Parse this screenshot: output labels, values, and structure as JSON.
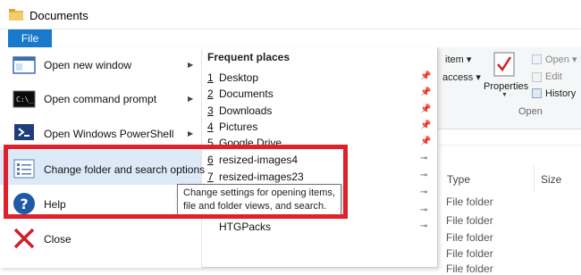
{
  "window": {
    "title": "Documents"
  },
  "ribbon": {
    "file_tab": "File",
    "item": "item",
    "access": "access",
    "properties": "Properties",
    "open": "Open",
    "edit": "Edit",
    "history": "History",
    "group_open": "Open"
  },
  "menu": {
    "items": [
      {
        "label": "Open new window",
        "icon": "window-icon",
        "has_submenu": true
      },
      {
        "label": "Open command prompt",
        "icon": "command-prompt-icon",
        "has_submenu": true
      },
      {
        "label": "Open Windows PowerShell",
        "icon": "powershell-icon",
        "has_submenu": true
      },
      {
        "label": "Change folder and search options",
        "icon": "folder-options-icon",
        "has_submenu": false
      },
      {
        "label": "Help",
        "icon": "help-icon",
        "has_submenu": true
      },
      {
        "label": "Close",
        "icon": "close-icon",
        "has_submenu": false
      }
    ]
  },
  "frequent_places": {
    "header": "Frequent places",
    "items": [
      {
        "num": "1",
        "label": "Desktop",
        "pinned": true
      },
      {
        "num": "2",
        "label": "Documents",
        "pinned": true
      },
      {
        "num": "3",
        "label": "Downloads",
        "pinned": true
      },
      {
        "num": "4",
        "label": "Pictures",
        "pinned": true
      },
      {
        "num": "5",
        "label": "Google Drive",
        "pinned": true
      },
      {
        "num": "6",
        "label": "resized-images4",
        "pinned": false
      },
      {
        "num": "7",
        "label": "resized-images23",
        "pinned": false
      },
      {
        "num": "",
        "label": "HTGPacks",
        "pinned": false
      }
    ]
  },
  "tooltip": {
    "line1": "Change settings for opening items,",
    "line2": "file and folder views, and search."
  },
  "file_list": {
    "columns": {
      "type": "Type",
      "size": "Size"
    },
    "rows": [
      "File folder",
      "File folder",
      "File folder",
      "File folder",
      "File folder"
    ]
  },
  "colors": {
    "accent": "#1979ca",
    "highlight": "#e0202a"
  }
}
